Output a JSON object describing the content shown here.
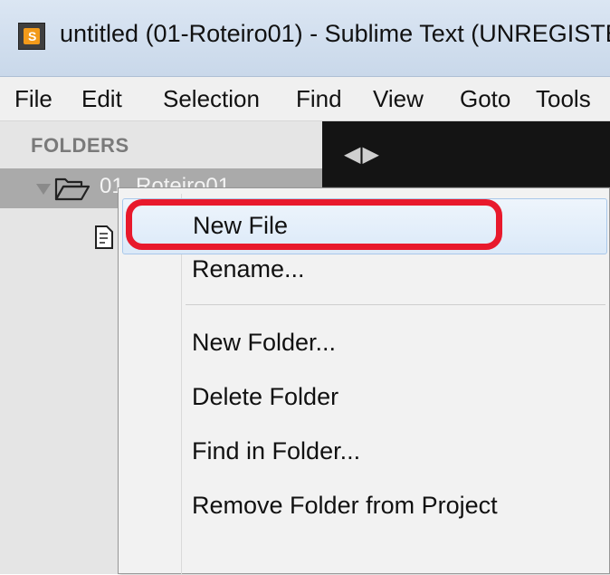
{
  "window": {
    "title": "untitled (01-Roteiro01) - Sublime Text (UNREGISTE",
    "app_icon": "sublime-text-icon",
    "app_icon_letter": "S"
  },
  "menubar": {
    "items": [
      "File",
      "Edit",
      "Selection",
      "Find",
      "View",
      "Goto",
      "Tools"
    ]
  },
  "sidebar": {
    "header": "FOLDERS",
    "folder_name": "01_Roteiro01",
    "folder_icon": "open-folder-icon",
    "file_icon": "document-icon"
  },
  "editor": {
    "tab_nav": "◀▶"
  },
  "context_menu": {
    "items": [
      {
        "label": "New File",
        "highlighted": true
      },
      {
        "label": "Rename..."
      },
      {
        "label": "New Folder..."
      },
      {
        "label": "Delete Folder"
      },
      {
        "label": "Find in Folder..."
      },
      {
        "label": "Remove Folder from Project"
      }
    ]
  },
  "colors": {
    "annotation": "#e8192c",
    "highlight_border": "#a9c8ea",
    "sidebar_bg": "#e5e5e5",
    "selected_row": "#aaaaaa",
    "editor_bg": "#141414"
  }
}
